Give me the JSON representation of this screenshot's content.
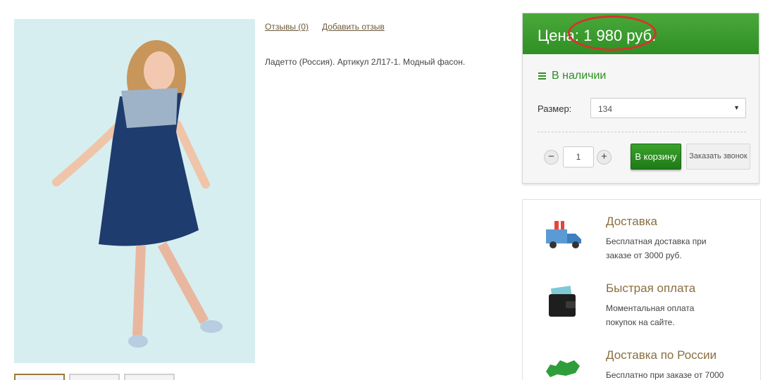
{
  "product": {
    "reviews_link": "Отзывы (0)",
    "add_review_link": "Добавить отзыв",
    "description": "Ладетто (Россия). Артикул 2Л17-1. Модный фасон."
  },
  "pricebox": {
    "price_label": "Цена: 1 980 руб.",
    "stock_label": "В наличии",
    "size_label": "Размер:",
    "size_value": "134",
    "quantity": "1",
    "minus": "−",
    "plus": "+",
    "cart_button": "В корзину",
    "call_button": "Заказать звонок",
    "accent_color": "#2f8f24",
    "highlight_color": "#d8322e"
  },
  "info": {
    "items": [
      {
        "title": "Доставка",
        "text1": "Бесплатная доставка при",
        "text2": "заказе от 3000 руб.",
        "icon": "delivery-truck-icon"
      },
      {
        "title": "Быстрая оплата",
        "text1": "Моментальная оплата",
        "text2": "покупок на сайте.",
        "icon": "wallet-icon"
      },
      {
        "title": "Доставка по России",
        "text1": "Бесплатно при заказе от 7000",
        "text2": "",
        "icon": "russia-map-icon"
      }
    ]
  }
}
